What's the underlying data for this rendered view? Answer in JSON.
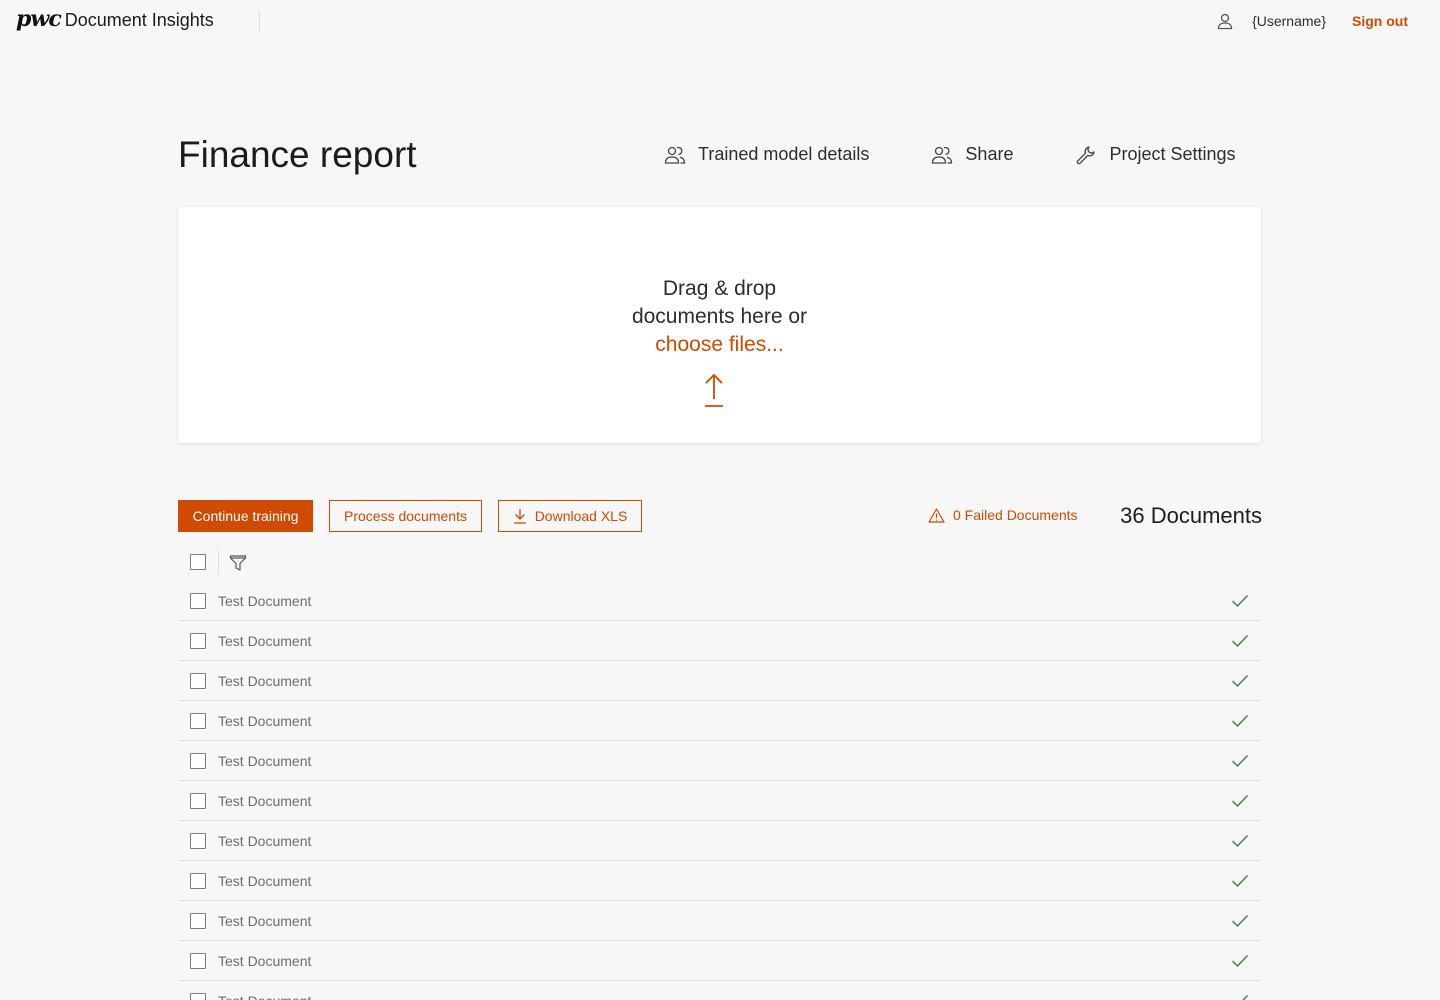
{
  "app": {
    "logo_text": "pwc",
    "name": "Document Insights"
  },
  "user": {
    "username": "{Username}",
    "sign_out_label": "Sign out"
  },
  "page": {
    "title": "Finance report",
    "actions": [
      {
        "label": "Trained model details",
        "icon": "people-icon"
      },
      {
        "label": "Share",
        "icon": "people-icon"
      },
      {
        "label": "Project Settings",
        "icon": "wrench-icon"
      }
    ]
  },
  "dropzone": {
    "line1": "Drag & drop",
    "line2": "documents here or",
    "choose_label": "choose files...",
    "icon": "upload-arrow-icon"
  },
  "toolbar": {
    "continue_training_label": "Continue training",
    "process_documents_label": "Process documents",
    "download_xls_label": "Download XLS",
    "failed_documents_label": "0 Failed Documents",
    "document_count_label": "36 Documents"
  },
  "documents": [
    {
      "name": "Test Document",
      "status": "processed"
    },
    {
      "name": "Test Document",
      "status": "processed"
    },
    {
      "name": "Test Document",
      "status": "processed"
    },
    {
      "name": "Test Document",
      "status": "processed"
    },
    {
      "name": "Test Document",
      "status": "processed"
    },
    {
      "name": "Test Document",
      "status": "processed"
    },
    {
      "name": "Test Document",
      "status": "processed"
    },
    {
      "name": "Test Document",
      "status": "processed"
    },
    {
      "name": "Test Document",
      "status": "processed"
    },
    {
      "name": "Test Document",
      "status": "processed"
    },
    {
      "name": "Test Document",
      "status": "processed"
    }
  ],
  "colors": {
    "accent": "#d04a02",
    "success": "#2e8540",
    "background": "#f7f7f7"
  }
}
